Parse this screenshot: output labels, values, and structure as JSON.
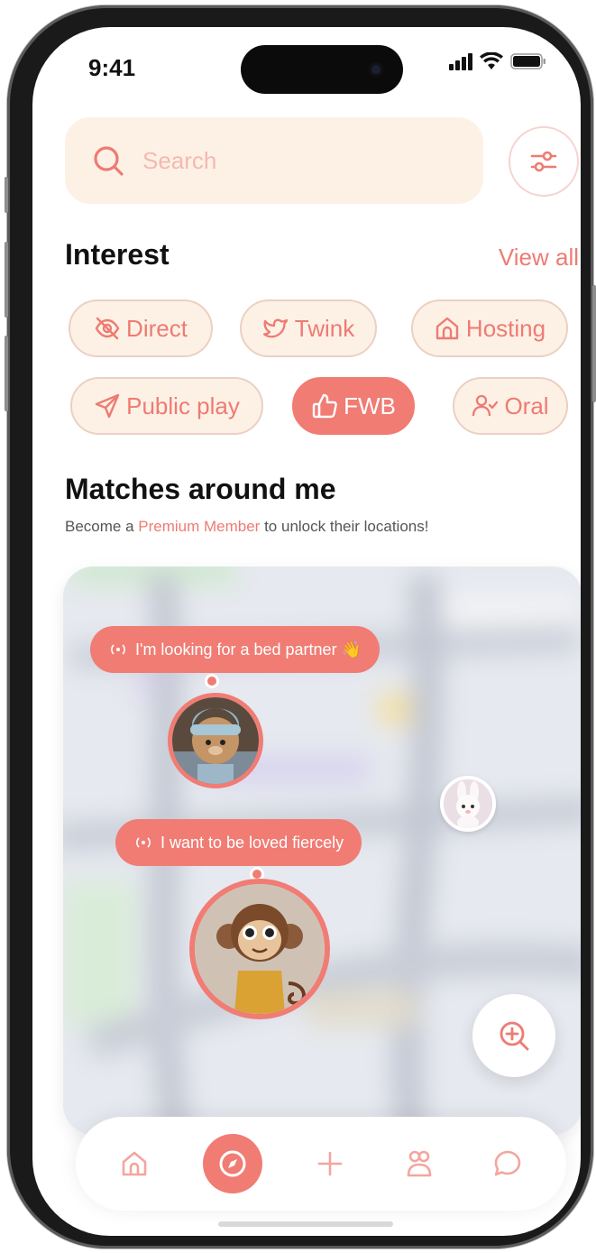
{
  "status_bar": {
    "time": "9:41"
  },
  "search": {
    "placeholder": "Search"
  },
  "interest": {
    "title": "Interest",
    "view_all": "View all",
    "chips": [
      {
        "label": "Direct",
        "icon": "eye-off-icon",
        "active": false
      },
      {
        "label": "Twink",
        "icon": "bird-icon",
        "active": false
      },
      {
        "label": "Hosting",
        "icon": "home-icon",
        "active": false
      },
      {
        "label": "Public play",
        "icon": "send-icon",
        "active": false
      },
      {
        "label": "FWB",
        "icon": "thumbs-up-icon",
        "active": true
      },
      {
        "label": "Oral",
        "icon": "user-check-icon",
        "active": false
      }
    ]
  },
  "matches": {
    "title": "Matches around me",
    "subtitle_prefix": "Become a ",
    "subtitle_link": "Premium Member",
    "subtitle_suffix": " to unlock their locations!",
    "pins": [
      {
        "message": "I'm looking for a bed partner 👋",
        "avatar": "bear-avatar"
      },
      {
        "message": "I want to be loved fiercely",
        "avatar": "monkey-avatar"
      },
      {
        "message": "",
        "avatar": "bunny-avatar"
      }
    ]
  },
  "tabbar": {
    "items": [
      {
        "icon": "home-icon",
        "active": false
      },
      {
        "icon": "compass-icon",
        "active": true
      },
      {
        "icon": "plus-icon",
        "active": false
      },
      {
        "icon": "people-icon",
        "active": false
      },
      {
        "icon": "chat-icon",
        "active": false
      }
    ]
  },
  "colors": {
    "accent": "#f07c74",
    "chip_bg": "#fdf1e6",
    "search_bg": "#fdf1e6"
  }
}
